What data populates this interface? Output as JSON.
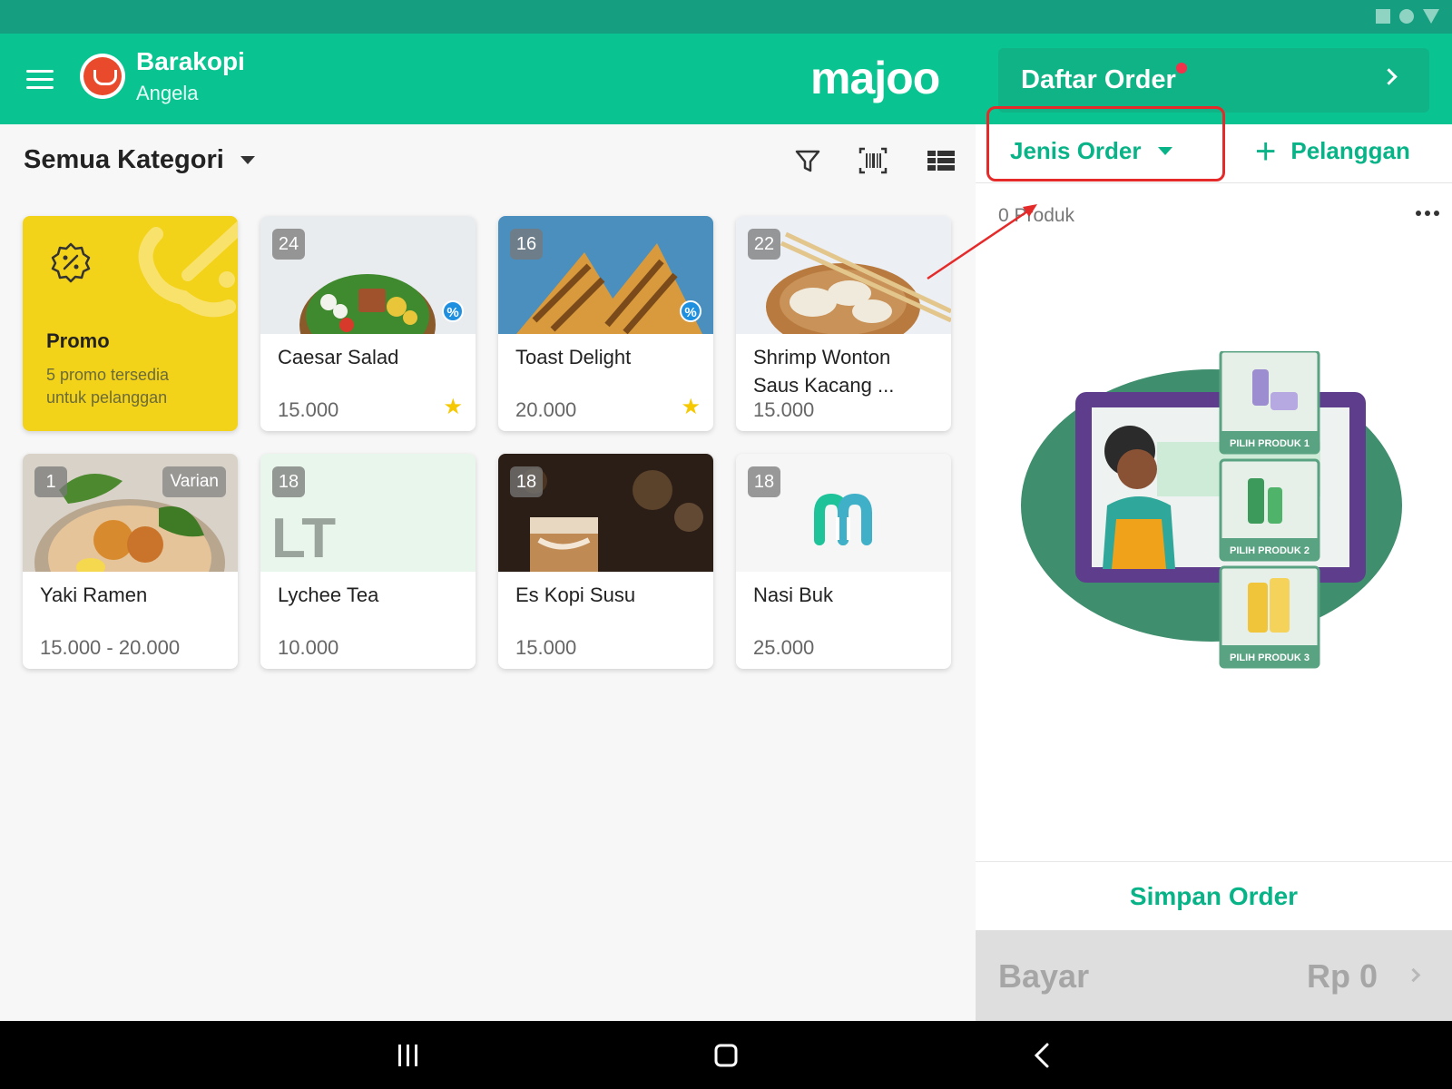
{
  "header": {
    "store_name": "Barakopi",
    "user_name": "Angela",
    "brand": "majoo",
    "order_list_label": "Daftar Order"
  },
  "catalog": {
    "category_label": "Semua Kategori",
    "tools": [
      "filter-icon",
      "barcode-icon",
      "grid-view-icon"
    ]
  },
  "promo": {
    "title": "Promo",
    "subtitle": "5 promo tersedia untuk pelanggan"
  },
  "products": [
    {
      "name": "Caesar Salad",
      "price": "15.000",
      "stock": "24",
      "discount": true,
      "favorite": true,
      "image": "salad"
    },
    {
      "name": "Toast Delight",
      "price": "20.000",
      "stock": "16",
      "discount": true,
      "favorite": true,
      "image": "toast"
    },
    {
      "name": "Shrimp Wonton Saus Kacang ...",
      "price": "15.000",
      "stock": "22",
      "discount": false,
      "favorite": false,
      "image": "wonton"
    },
    {
      "name": "Yaki Ramen",
      "price": "15.000 - 20.000",
      "stock": "1",
      "variant": "Varian",
      "discount": false,
      "favorite": false,
      "image": "ramen"
    },
    {
      "name": "Lychee Tea",
      "price": "10.000",
      "stock": "18",
      "discount": false,
      "favorite": false,
      "image": "initials",
      "initials": "LT"
    },
    {
      "name": "Es Kopi Susu",
      "price": "15.000",
      "stock": "18",
      "discount": false,
      "favorite": false,
      "image": "coffee"
    },
    {
      "name": "Nasi Buk",
      "price": "25.000",
      "stock": "18",
      "discount": false,
      "favorite": false,
      "image": "logo"
    }
  ],
  "order": {
    "order_type_label": "Jenis Order",
    "customer_label": "Pelanggan",
    "product_count": "0 Produk",
    "illustration_labels": [
      "PILIH PRODUK 1",
      "PILIH PRODUK 2",
      "PILIH PRODUK 3"
    ],
    "save_label": "Simpan Order",
    "pay_label": "Bayar",
    "pay_amount": "Rp 0"
  },
  "colors": {
    "primary": "#09c391",
    "accent_text": "#09b388",
    "promo": "#f3d21a",
    "annotation": "#e52a2a"
  }
}
